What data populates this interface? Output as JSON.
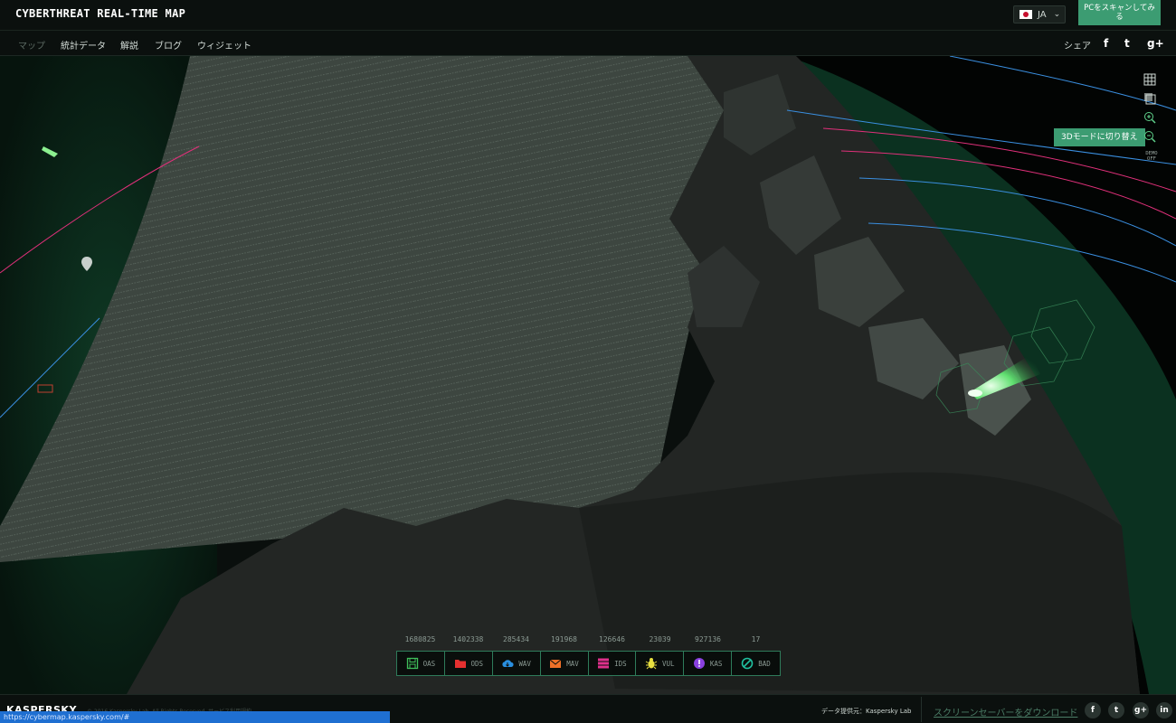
{
  "header": {
    "title": "CYBERTHREAT REAL-TIME MAP",
    "language": "JA",
    "scan_button": "PCをスキャンしてみる"
  },
  "nav": {
    "items": [
      {
        "label": "マップ",
        "active": true
      },
      {
        "label": "統計データ",
        "active": false
      },
      {
        "label": "解説",
        "active": false
      },
      {
        "label": "ブログ",
        "active": false
      },
      {
        "label": "ウィジェット",
        "active": false
      }
    ],
    "share_label": "シェア",
    "social": [
      "f",
      "t",
      "g+"
    ]
  },
  "controls": {
    "mode_tooltip": "3Dモードに切り替え",
    "demo_label": "DEMO OFF"
  },
  "stats": [
    {
      "count": "1680825",
      "label": "OAS",
      "color": "#3fbf5a",
      "icon": "save-icon"
    },
    {
      "count": "1402338",
      "label": "ODS",
      "color": "#e63030",
      "icon": "folder-icon"
    },
    {
      "count": "285434",
      "label": "WAV",
      "color": "#2a8fe0",
      "icon": "cloud-icon"
    },
    {
      "count": "191968",
      "label": "MAV",
      "color": "#f07028",
      "icon": "mail-icon"
    },
    {
      "count": "126646",
      "label": "IDS",
      "color": "#e0308c",
      "icon": "ids-icon"
    },
    {
      "count": "23039",
      "label": "VUL",
      "color": "#e8e040",
      "icon": "bug-icon"
    },
    {
      "count": "927136",
      "label": "KAS",
      "color": "#8a40e0",
      "icon": "alert-icon"
    },
    {
      "count": "17",
      "label": "BAD",
      "color": "#20c0a0",
      "icon": "block-icon"
    }
  ],
  "footer": {
    "logo": "KASPERSKY",
    "copyright": "© 2016 Kaspersky Lab. All Rights Reserved.  サービス利用規約",
    "provider": "データ提供元：Kaspersky Lab",
    "download": "スクリーンセーバーをダウンロード",
    "social": [
      "f",
      "t",
      "g+",
      "in"
    ]
  },
  "status_url": "https://cybermap.kaspersky.com/#",
  "colors": {
    "accent": "#3c9c72",
    "background": "#050807"
  }
}
